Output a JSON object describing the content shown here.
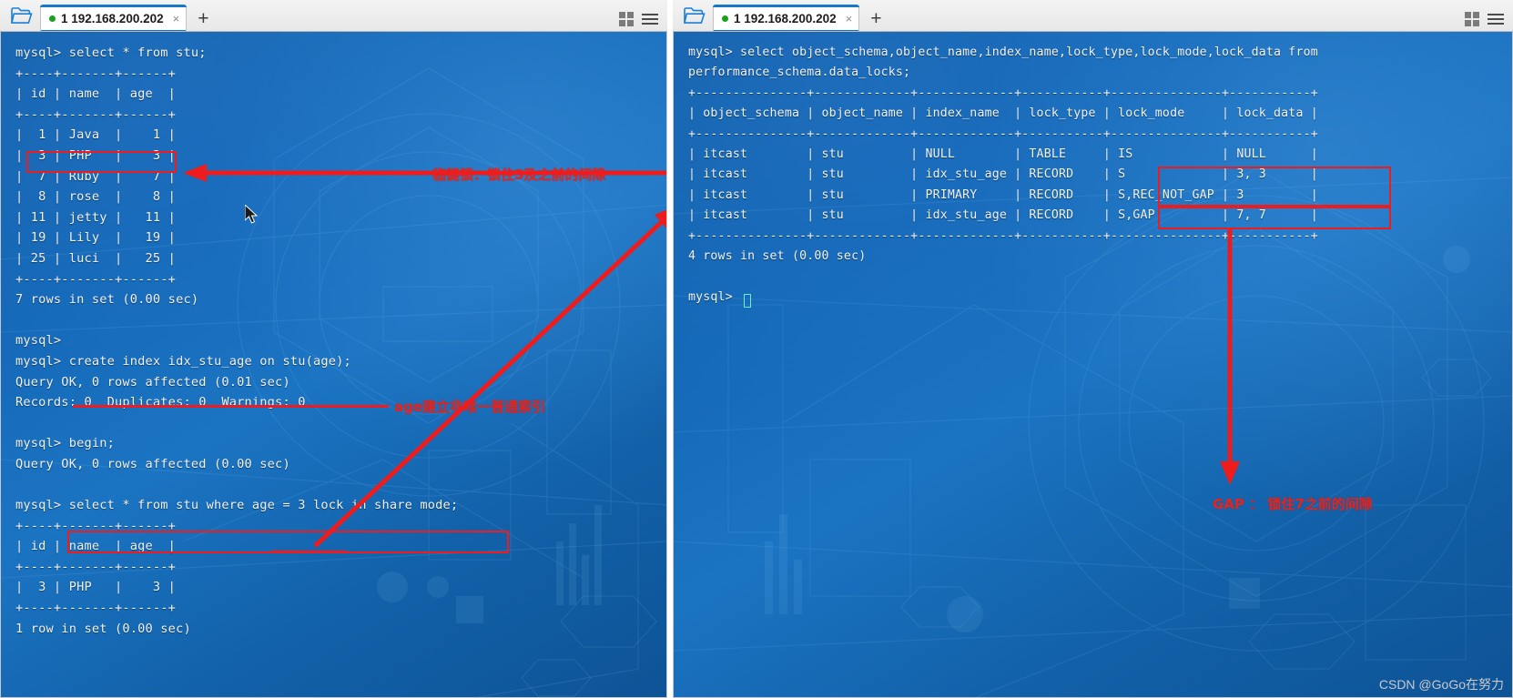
{
  "left_window": {
    "folder_icon": "folder-open-icon",
    "tab": {
      "title": "1 192.168.200.202",
      "status_dot_color": "#18a11c",
      "close_label": "×"
    },
    "new_tab_label": "+",
    "grid_icon": "grid-view-icon",
    "menu_icon": "hamburger-menu-icon",
    "console_text": "mysql> select * from stu;\n+----+-------+------+\n| id | name  | age  |\n+----+-------+------+\n|  1 | Java  |    1 |\n|  3 | PHP   |    3 |\n|  7 | Ruby  |    7 |\n|  8 | rose  |    8 |\n| 11 | jetty |   11 |\n| 19 | Lily  |   19 |\n| 25 | luci  |   25 |\n+----+-------+------+\n7 rows in set (0.00 sec)\n\nmysql>\nmysql> create index idx_stu_age on stu(age);\nQuery OK, 0 rows affected (0.01 sec)\nRecords: 0  Duplicates: 0  Warnings: 0\n\nmysql> begin;\nQuery OK, 0 rows affected (0.00 sec)\n\nmysql> select * from stu where age = 3 lock in share mode;\n+----+-------+------+\n| id | name  | age  |\n+----+-------+------+\n|  3 | PHP   |    3 |\n+----+-------+------+\n1 row in set (0.00 sec)"
  },
  "right_window": {
    "folder_icon": "folder-open-icon",
    "tab": {
      "title": "1 192.168.200.202",
      "status_dot_color": "#18a11c",
      "close_label": "×"
    },
    "new_tab_label": "+",
    "grid_icon": "grid-view-icon",
    "menu_icon": "hamburger-menu-icon",
    "console_text": "mysql> select object_schema,object_name,index_name,lock_type,lock_mode,lock_data from\nperformance_schema.data_locks;\n+---------------+-------------+-------------+-----------+---------------+-----------+\n| object_schema | object_name | index_name  | lock_type | lock_mode     | lock_data |\n+---------------+-------------+-------------+-----------+---------------+-----------+\n| itcast        | stu         | NULL        | TABLE     | IS            | NULL      |\n| itcast        | stu         | idx_stu_age | RECORD    | S             | 3, 3      |\n| itcast        | stu         | PRIMARY     | RECORD    | S,REC_NOT_GAP | 3         |\n| itcast        | stu         | idx_stu_age | RECORD    | S,GAP         | 7, 7      |\n+---------------+-------------+-------------+-----------+---------------+-----------+\n4 rows in set (0.00 sec)\n\nmysql>"
  },
  "annotations": {
    "color": "#ee1c1c",
    "next_key_lock_note": "临键锁：锁住3及之前的间隙",
    "index_note": "age建立非唯一普通索引",
    "gap_note": "GAP ： 锁住7之前的间隙"
  },
  "watermark": "CSDN @GoGo在努力",
  "table_left": {
    "headers": [
      "id",
      "name",
      "age"
    ],
    "rows": [
      [
        "1",
        "Java",
        "1"
      ],
      [
        "3",
        "PHP",
        "3"
      ],
      [
        "7",
        "Ruby",
        "7"
      ],
      [
        "8",
        "rose",
        "8"
      ],
      [
        "11",
        "jetty",
        "11"
      ],
      [
        "19",
        "Lily",
        "19"
      ],
      [
        "25",
        "luci",
        "25"
      ]
    ],
    "footer": "7 rows in set (0.00 sec)"
  },
  "table_right": {
    "headers": [
      "object_schema",
      "object_name",
      "index_name",
      "lock_type",
      "lock_mode",
      "lock_data"
    ],
    "rows": [
      [
        "itcast",
        "stu",
        "NULL",
        "TABLE",
        "IS",
        "NULL"
      ],
      [
        "itcast",
        "stu",
        "idx_stu_age",
        "RECORD",
        "S",
        "3, 3"
      ],
      [
        "itcast",
        "stu",
        "PRIMARY",
        "RECORD",
        "S,REC_NOT_GAP",
        "3"
      ],
      [
        "itcast",
        "stu",
        "idx_stu_age",
        "RECORD",
        "S,GAP",
        "7, 7"
      ]
    ],
    "footer": "4 rows in set (0.00 sec)"
  }
}
